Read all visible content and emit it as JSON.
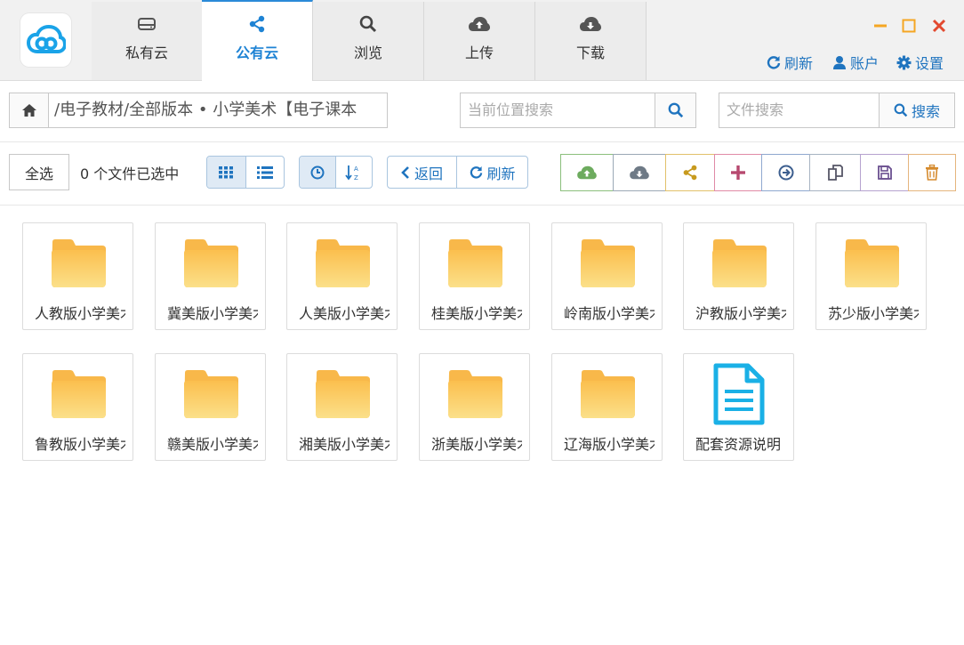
{
  "header": {
    "tabs": [
      {
        "label": "私有云",
        "icon": "hard-drive-icon"
      },
      {
        "label": "公有云",
        "icon": "share-icon"
      },
      {
        "label": "浏览",
        "icon": "search-icon"
      },
      {
        "label": "上传",
        "icon": "cloud-upload-icon"
      },
      {
        "label": "下载",
        "icon": "cloud-download-icon"
      }
    ],
    "refresh_label": "刷新",
    "account_label": "账户",
    "settings_label": "设置"
  },
  "address": {
    "path": "/电子教材/全部版本 • 小学美术【电子课本",
    "location_search_placeholder": "当前位置搜索",
    "file_search_placeholder": "文件搜索",
    "search_label": "搜索"
  },
  "toolbar": {
    "select_all_label": "全选",
    "selected_count_text": "0 个文件已选中",
    "back_label": "返回",
    "refresh_label": "刷新"
  },
  "colors": {
    "accent": "#1f74bf",
    "folder": "#fbc85a",
    "doc": "#1ab0e6",
    "minimize": "#f5a623",
    "maximize": "#f5a623",
    "close": "#e2492f"
  },
  "files": [
    {
      "name": "人教版小学美术",
      "type": "folder"
    },
    {
      "name": "冀美版小学美术",
      "type": "folder"
    },
    {
      "name": "人美版小学美术",
      "type": "folder"
    },
    {
      "name": "桂美版小学美术",
      "type": "folder"
    },
    {
      "name": "岭南版小学美术",
      "type": "folder"
    },
    {
      "name": "沪教版小学美术",
      "type": "folder"
    },
    {
      "name": "苏少版小学美术",
      "type": "folder"
    },
    {
      "name": "鲁教版小学美术",
      "type": "folder"
    },
    {
      "name": "赣美版小学美术",
      "type": "folder"
    },
    {
      "name": "湘美版小学美术",
      "type": "folder"
    },
    {
      "name": "浙美版小学美术",
      "type": "folder"
    },
    {
      "name": "辽海版小学美术",
      "type": "folder"
    },
    {
      "name": "配套资源说明",
      "type": "document"
    }
  ]
}
